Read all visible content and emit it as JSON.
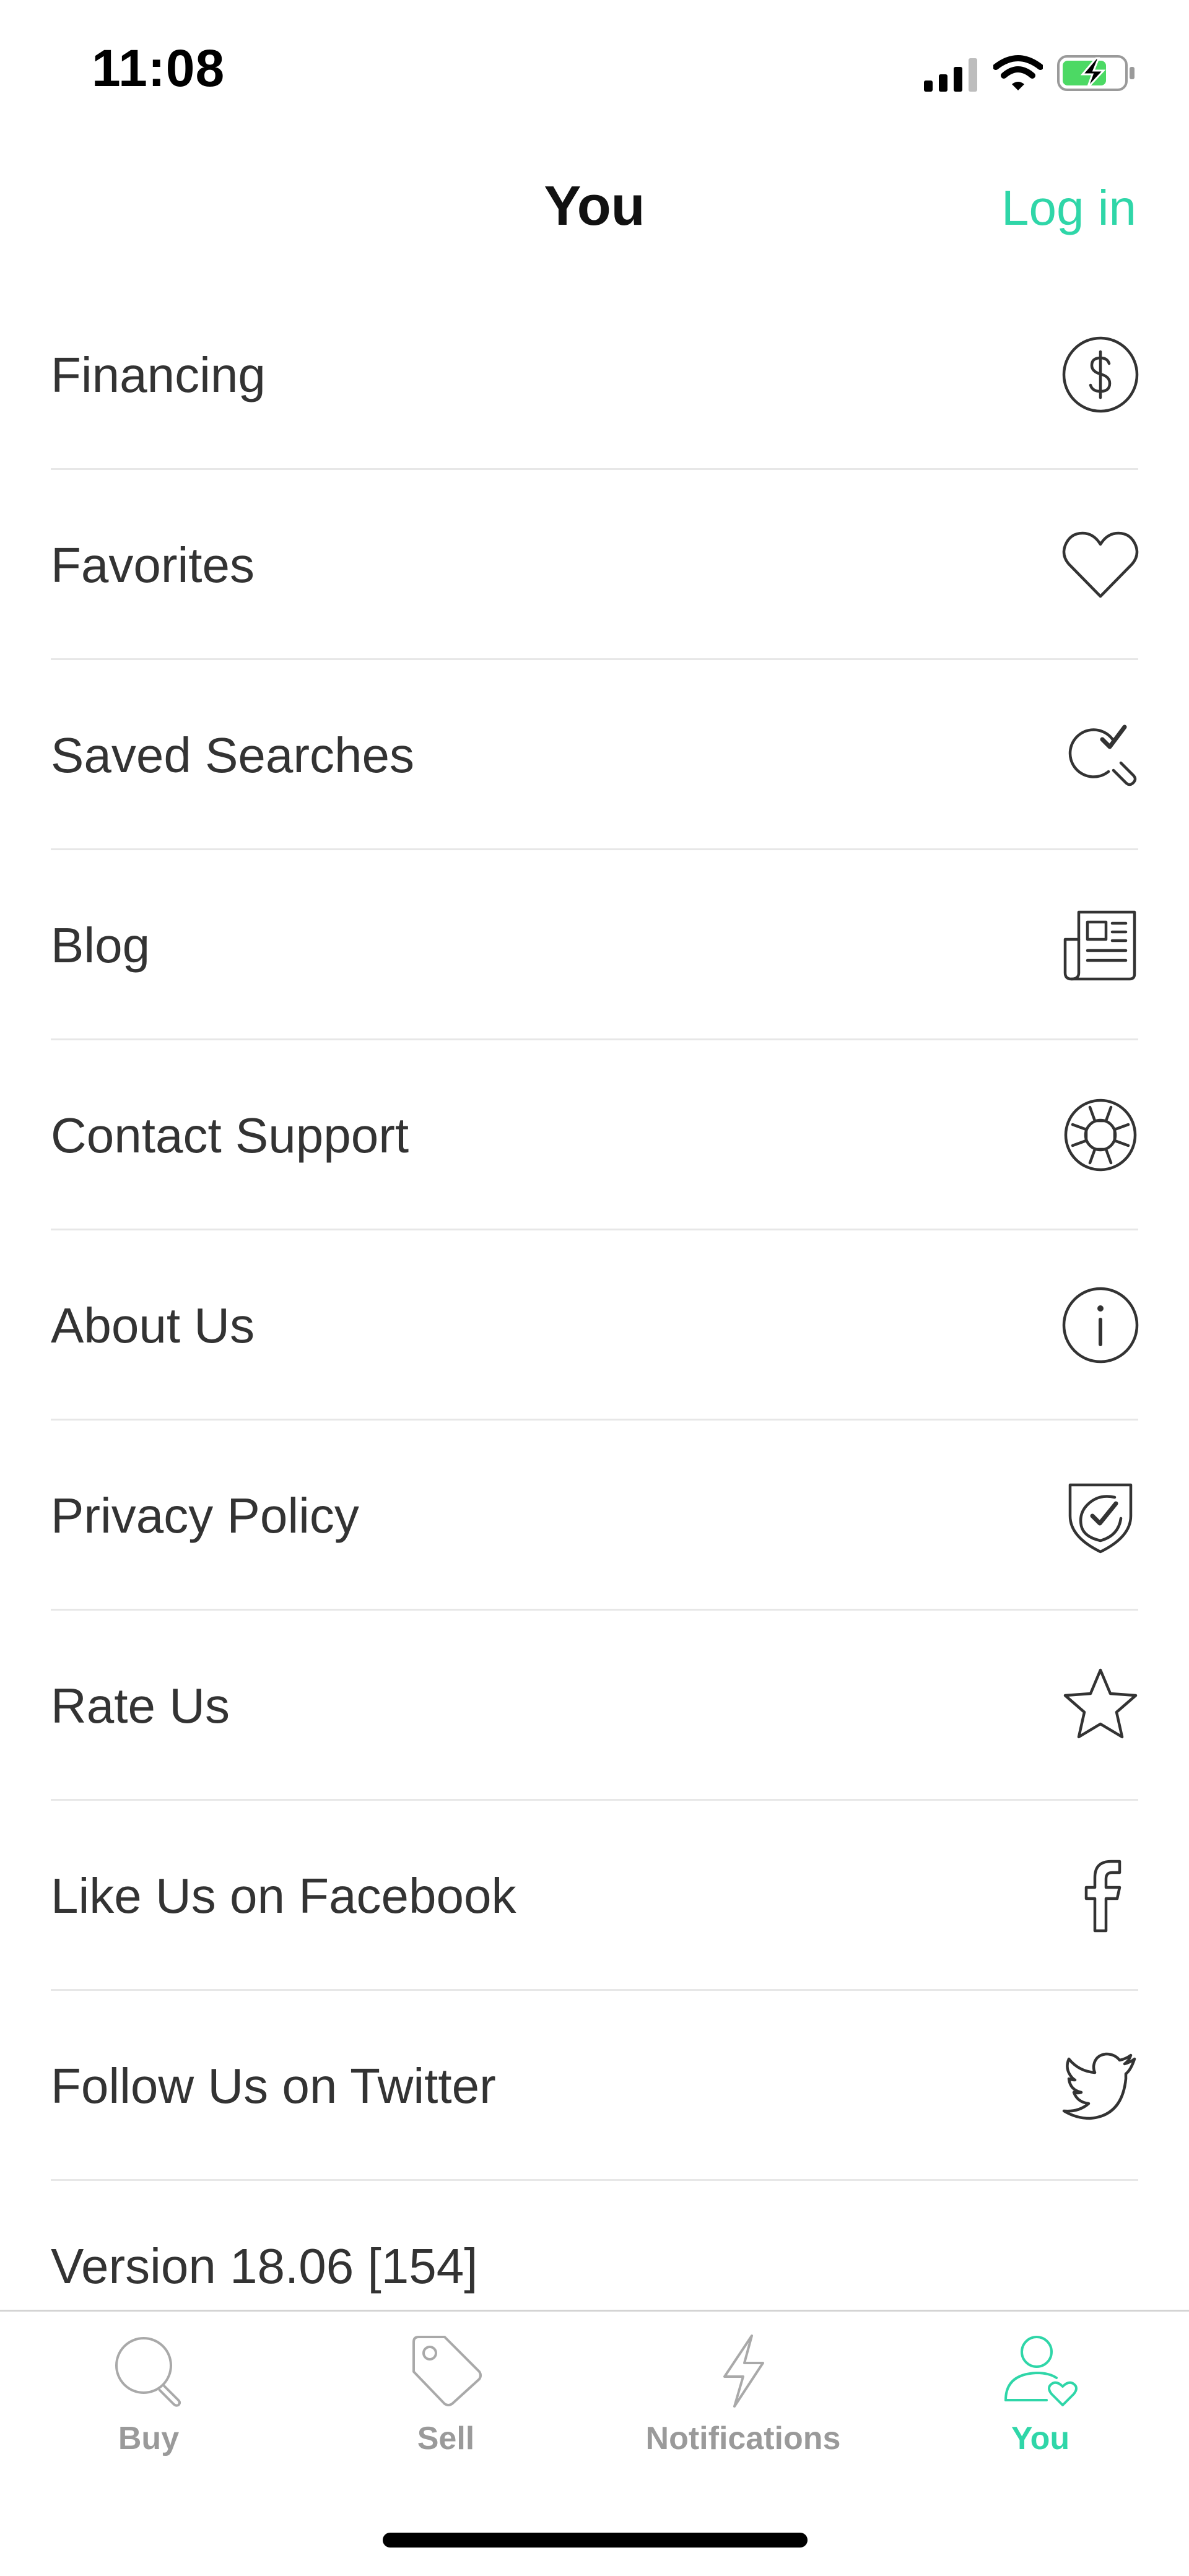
{
  "status_bar": {
    "time": "11:08"
  },
  "header": {
    "title": "You",
    "login_label": "Log in"
  },
  "menu": {
    "items": [
      {
        "label": "Financing",
        "icon": "dollar-circle-icon"
      },
      {
        "label": "Favorites",
        "icon": "heart-icon"
      },
      {
        "label": "Saved Searches",
        "icon": "search-check-icon"
      },
      {
        "label": "Blog",
        "icon": "newspaper-icon"
      },
      {
        "label": "Contact Support",
        "icon": "lifebuoy-icon"
      },
      {
        "label": "About Us",
        "icon": "info-circle-icon"
      },
      {
        "label": "Privacy Policy",
        "icon": "shield-check-icon"
      },
      {
        "label": "Rate Us",
        "icon": "star-icon"
      },
      {
        "label": "Like Us on Facebook",
        "icon": "facebook-icon"
      },
      {
        "label": "Follow Us on Twitter",
        "icon": "twitter-icon"
      }
    ],
    "version": "Version 18.06 [154]"
  },
  "tab_bar": {
    "tabs": [
      {
        "label": "Buy",
        "icon": "search-icon",
        "active": false
      },
      {
        "label": "Sell",
        "icon": "tag-icon",
        "active": false
      },
      {
        "label": "Notifications",
        "icon": "lightning-icon",
        "active": false
      },
      {
        "label": "You",
        "icon": "user-heart-icon",
        "active": true
      }
    ]
  },
  "colors": {
    "accent": "#2fd6a8",
    "text": "#333333",
    "divider": "#e7e7e7",
    "inactive_tab": "#9a9a9a"
  }
}
